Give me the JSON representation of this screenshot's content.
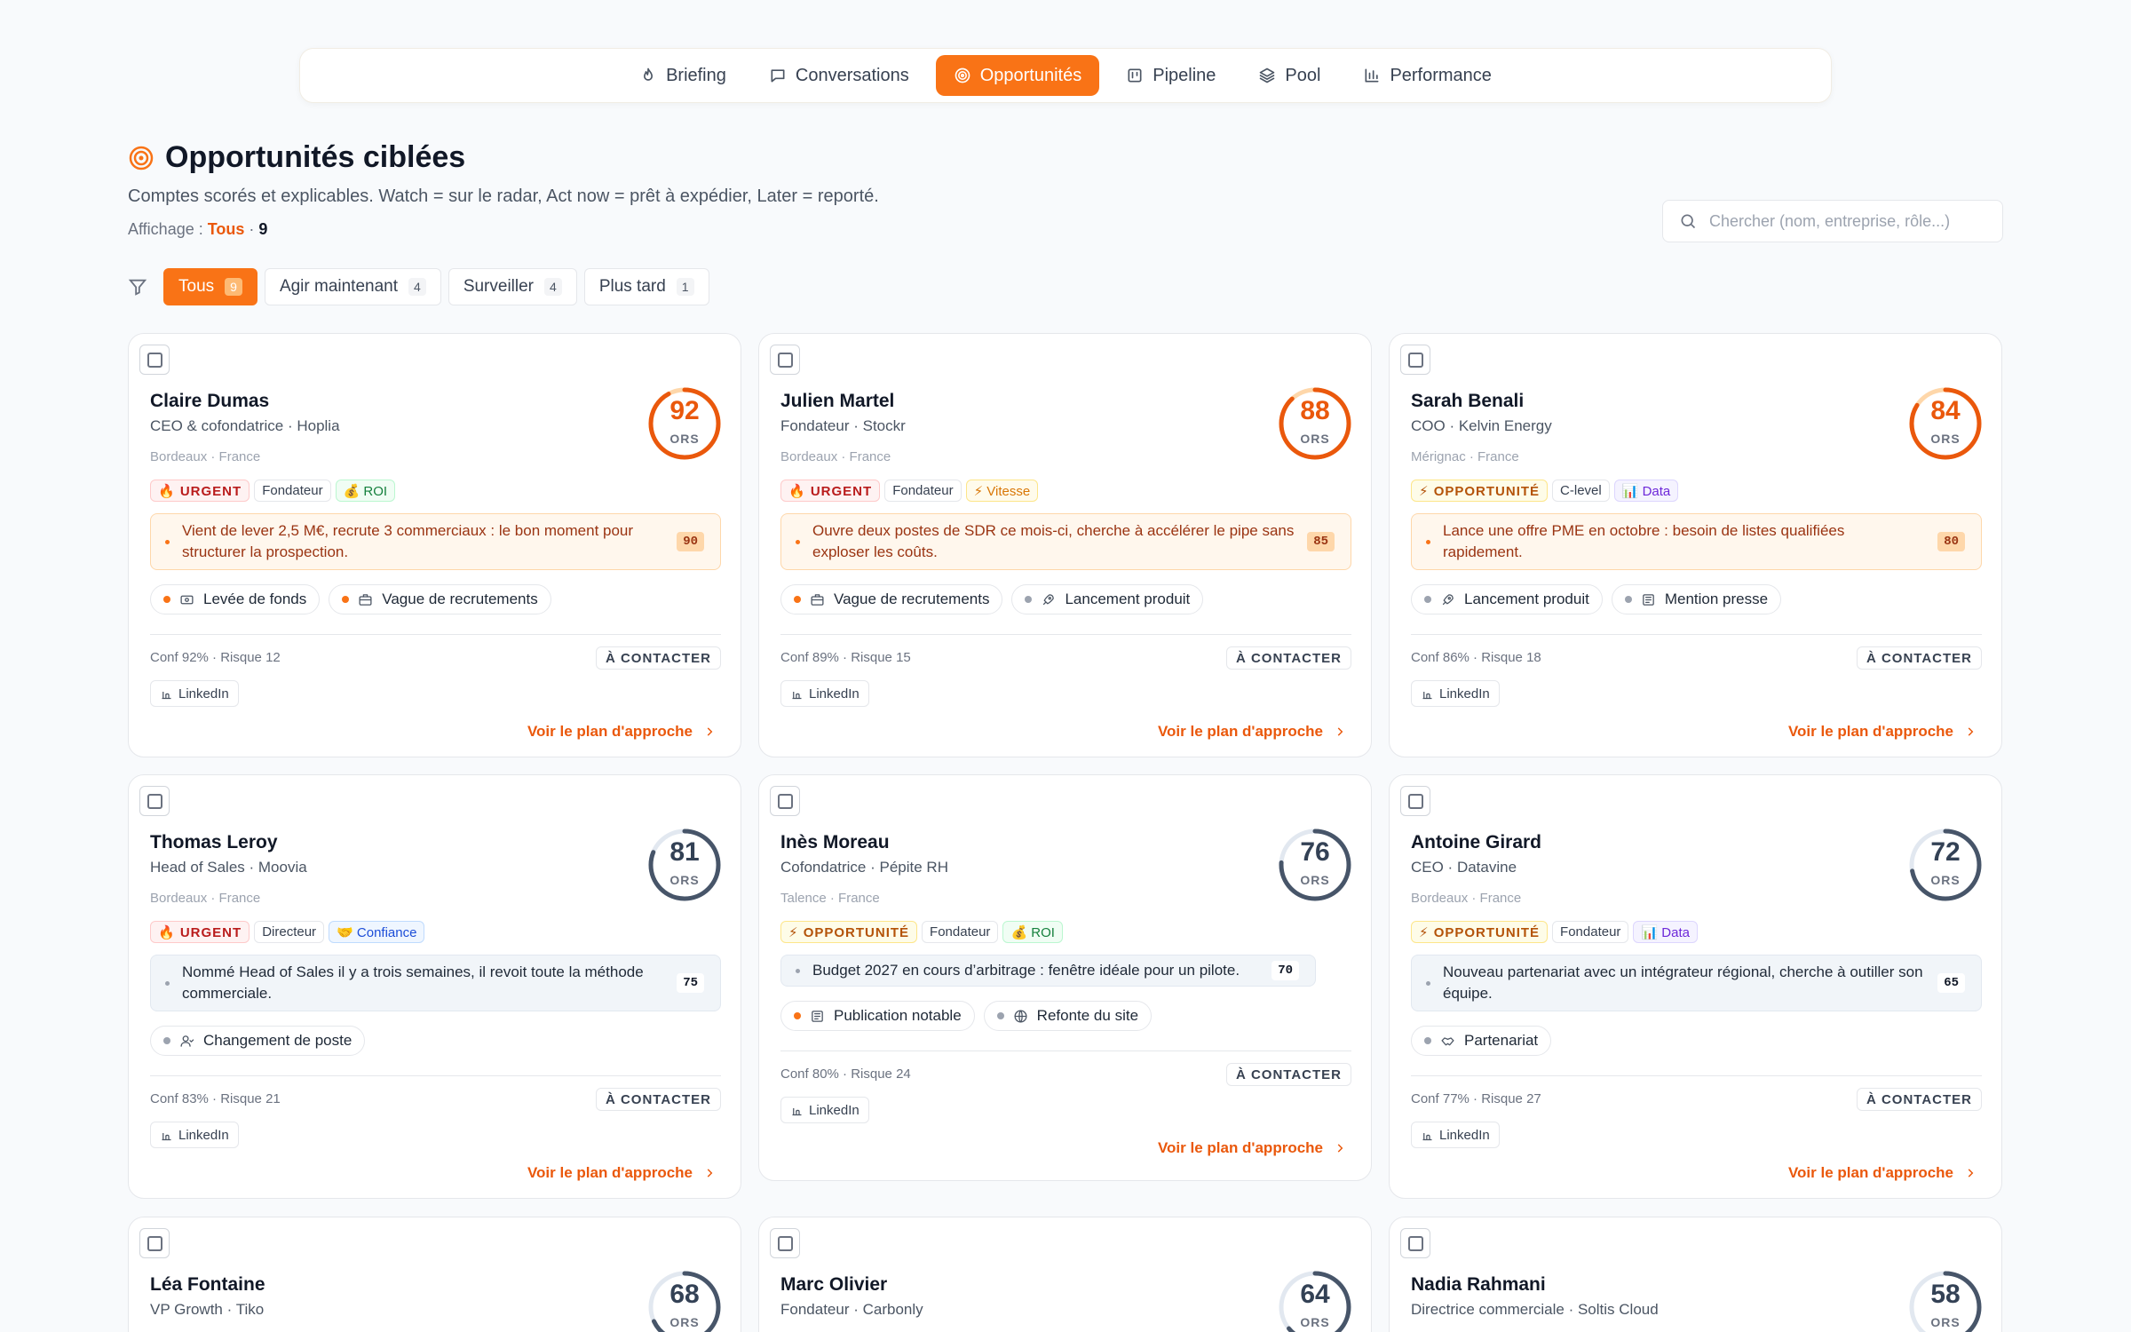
{
  "nav": {
    "tabs": [
      {
        "label": "Briefing",
        "icon": "flame-icon"
      },
      {
        "label": "Conversations",
        "icon": "chat-icon"
      },
      {
        "label": "Opportunités",
        "icon": "target-icon",
        "active": true
      },
      {
        "label": "Pipeline",
        "icon": "kanban-icon"
      },
      {
        "label": "Pool",
        "icon": "layers-icon"
      },
      {
        "label": "Performance",
        "icon": "bar-chart-icon"
      }
    ]
  },
  "header": {
    "title": "Opportunités ciblées",
    "subtitle": "Comptes scorés et explicables. Watch = sur le radar, Act now = prêt à expédier, Later = reporté.",
    "display_label": "Affichage : ",
    "display_selected": "Tous",
    "display_sep": " · ",
    "display_count": "9"
  },
  "search": {
    "placeholder": "Chercher (nom, entreprise, rôle...)",
    "value": ""
  },
  "filters": [
    {
      "label": "Tous",
      "count": "9",
      "active": true
    },
    {
      "label": "Agir maintenant",
      "count": "4"
    },
    {
      "label": "Surveiller",
      "count": "4"
    },
    {
      "label": "Plus tard",
      "count": "1"
    }
  ],
  "accent_color": "#f97316",
  "cards": [
    {
      "name": "Claire Dumas",
      "role": "CEO & cofondatrice · Hoplia",
      "location": "Bordeaux · France",
      "score": 92,
      "score_label": "ORS",
      "hot": true,
      "tags": [
        {
          "label": "🔥 URGENT",
          "kind": "urgent"
        },
        {
          "label": "Fondateur",
          "kind": "plain"
        },
        {
          "label": "💰 ROI",
          "kind": "green"
        }
      ],
      "signal": "Vient de lever 2,5 M€, recrute 3 commerciaux : le bon moment pour structurer la prospection.",
      "signal_score": "90",
      "events": [
        {
          "label": "Levée de fonds",
          "icon": "cash-icon",
          "hot": true
        },
        {
          "label": "Vague de recrutements",
          "icon": "briefcase-icon",
          "hot": true
        }
      ],
      "meta": "Conf 92% · Risque 12",
      "status": "À CONTACTER",
      "channel": "LinkedIn",
      "cta": "Voir le plan d'approche"
    },
    {
      "name": "Julien Martel",
      "role": "Fondateur · Stockr",
      "location": "Bordeaux · France",
      "score": 88,
      "score_label": "ORS",
      "hot": true,
      "tags": [
        {
          "label": "🔥 URGENT",
          "kind": "urgent"
        },
        {
          "label": "Fondateur",
          "kind": "plain"
        },
        {
          "label": "⚡ Vitesse",
          "kind": "yellow"
        }
      ],
      "signal": "Ouvre deux postes de SDR ce mois-ci, cherche à accélérer le pipe sans exploser les coûts.",
      "signal_score": "85",
      "events": [
        {
          "label": "Vague de recrutements",
          "icon": "briefcase-icon",
          "hot": true
        },
        {
          "label": "Lancement produit",
          "icon": "rocket-icon",
          "hot": false
        }
      ],
      "meta": "Conf 89% · Risque 15",
      "status": "À CONTACTER",
      "channel": "LinkedIn",
      "cta": "Voir le plan d'approche"
    },
    {
      "name": "Sarah Benali",
      "role": "COO · Kelvin Energy",
      "location": "Mérignac · France",
      "score": 84,
      "score_label": "ORS",
      "hot": true,
      "tags": [
        {
          "label": "⚡ OPPORTUNITÉ",
          "kind": "opp"
        },
        {
          "label": "C-level",
          "kind": "plain"
        },
        {
          "label": "📊 Data",
          "kind": "purple"
        }
      ],
      "signal": "Lance une offre PME en octobre : besoin de listes qualifiées rapidement.",
      "signal_score": "80",
      "events": [
        {
          "label": "Lancement produit",
          "icon": "rocket-icon",
          "hot": false
        },
        {
          "label": "Mention presse",
          "icon": "newspaper-icon",
          "hot": false
        }
      ],
      "meta": "Conf 86% · Risque 18",
      "status": "À CONTACTER",
      "channel": "LinkedIn",
      "cta": "Voir le plan d'approche"
    },
    {
      "name": "Thomas Leroy",
      "role": "Head of Sales · Moovia",
      "location": "Bordeaux · France",
      "score": 81,
      "score_label": "ORS",
      "hot": false,
      "tags": [
        {
          "label": "🔥 URGENT",
          "kind": "urgent"
        },
        {
          "label": "Directeur",
          "kind": "plain"
        },
        {
          "label": "🤝 Confiance",
          "kind": "blue"
        }
      ],
      "signal": "Nommé Head of Sales il y a trois semaines, il revoit toute la méthode commerciale.",
      "signal_score": "75",
      "events": [
        {
          "label": "Changement de poste",
          "icon": "user-icon",
          "hot": false
        }
      ],
      "meta": "Conf 83% · Risque 21",
      "status": "À CONTACTER",
      "channel": "LinkedIn",
      "cta": "Voir le plan d'approche"
    },
    {
      "name": "Inès Moreau",
      "role": "Cofondatrice · Pépite RH",
      "location": "Talence · France",
      "score": 76,
      "score_label": "ORS",
      "hot": false,
      "short": true,
      "tags": [
        {
          "label": "⚡ OPPORTUNITÉ",
          "kind": "opp"
        },
        {
          "label": "Fondateur",
          "kind": "plain"
        },
        {
          "label": "💰 ROI",
          "kind": "green"
        }
      ],
      "signal": "Budget 2027 en cours d’arbitrage : fenêtre idéale pour un pilote.",
      "signal_score": "70",
      "events": [
        {
          "label": "Publication notable",
          "icon": "newspaper-icon",
          "hot": true
        },
        {
          "label": "Refonte du site",
          "icon": "globe-icon",
          "hot": false
        }
      ],
      "meta": "Conf 80% · Risque 24",
      "status": "À CONTACTER",
      "channel": "LinkedIn",
      "cta": "Voir le plan d'approche"
    },
    {
      "name": "Antoine Girard",
      "role": "CEO · Datavine",
      "location": "Bordeaux · France",
      "score": 72,
      "score_label": "ORS",
      "hot": false,
      "tags": [
        {
          "label": "⚡ OPPORTUNITÉ",
          "kind": "opp"
        },
        {
          "label": "Fondateur",
          "kind": "plain"
        },
        {
          "label": "📊 Data",
          "kind": "purple"
        }
      ],
      "signal": "Nouveau partenariat avec un intégrateur régional, cherche à outiller son équipe.",
      "signal_score": "65",
      "events": [
        {
          "label": "Partenariat",
          "icon": "handshake-icon",
          "hot": false
        }
      ],
      "meta": "Conf 77% · Risque 27",
      "status": "À CONTACTER",
      "channel": "LinkedIn",
      "cta": "Voir le plan d'approche"
    },
    {
      "name": "Léa Fontaine",
      "role": "VP Growth · Tiko",
      "score": 68,
      "score_label": "ORS",
      "partial": true
    },
    {
      "name": "Marc Olivier",
      "role": "Fondateur · Carbonly",
      "score": 64,
      "score_label": "ORS",
      "partial": true
    },
    {
      "name": "Nadia Rahmani",
      "role": "Directrice commerciale · Soltis Cloud",
      "score": 58,
      "score_label": "ORS",
      "partial": true
    }
  ]
}
